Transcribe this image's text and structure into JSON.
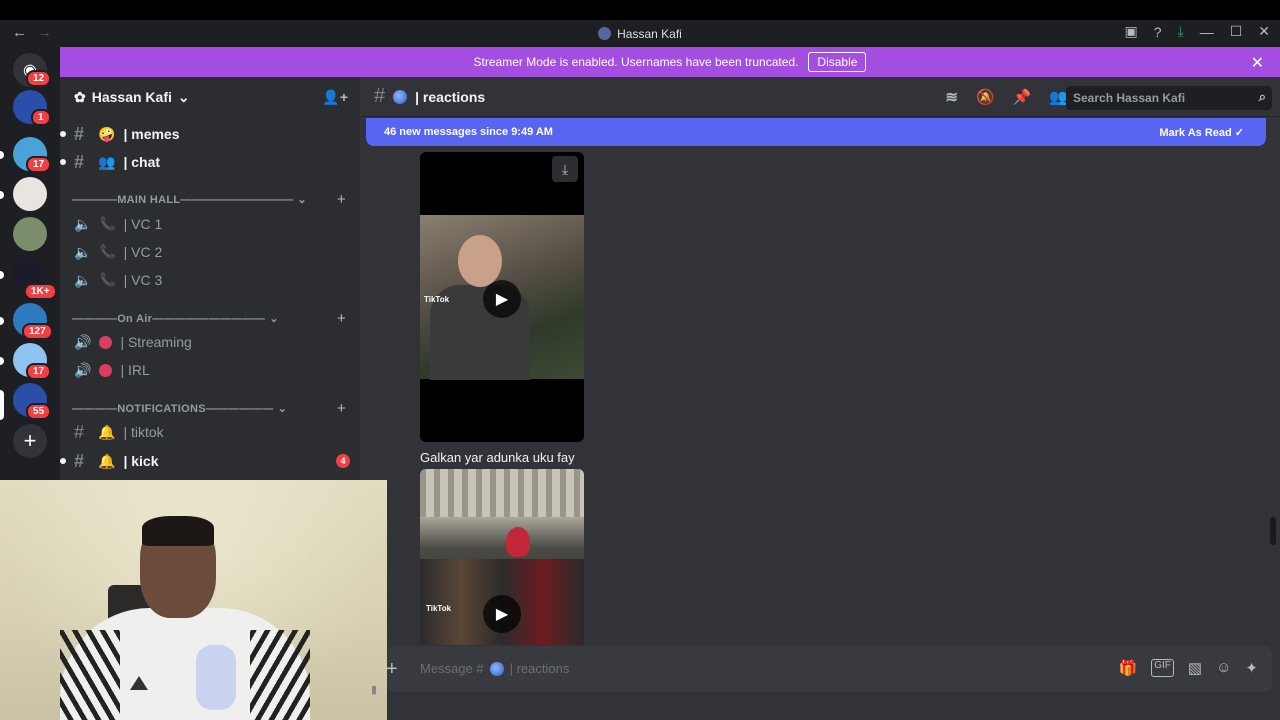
{
  "window": {
    "title": "Hassan Kafi",
    "back": "←",
    "forward": "→"
  },
  "banner": {
    "text": "Streamer Mode is enabled. Usernames have been truncated.",
    "button": "Disable",
    "close": "✕"
  },
  "servers": [
    {
      "name": "discord-home",
      "badge": "12",
      "color": "#5865f2"
    },
    {
      "name": "server-1",
      "badge": "1",
      "color": "#2b4fa8"
    },
    {
      "name": "server-2",
      "badge": "17",
      "color": "#4aa3d8"
    },
    {
      "name": "server-3",
      "badge": "",
      "color": "#e8e4df"
    },
    {
      "name": "server-4",
      "badge": "",
      "color": "#7b8d6a"
    },
    {
      "name": "server-5",
      "badge": "1K+",
      "color": "#1b1b2a"
    },
    {
      "name": "server-6",
      "badge": "127",
      "color": "#2d7bbf"
    },
    {
      "name": "server-7",
      "badge": "17",
      "color": "#8fc3f0"
    },
    {
      "name": "server-8",
      "badge": "55",
      "color": "#2b4fa8"
    }
  ],
  "guild": {
    "name": "Hassan Kafi",
    "chevron": "⌄"
  },
  "channels": {
    "memes": "| memes",
    "chat": "| chat",
    "cat_main": "————MAIN HALL——————————",
    "vc1": "| VC 1",
    "vc2": "| VC 2",
    "vc3": "| VC 3",
    "cat_onair": "————On Air——————————",
    "streaming": "| Streaming",
    "irl": "| IRL",
    "cat_notif": "————NOTIFICATIONS——————",
    "tiktok": "| tiktok",
    "kick": "| kick",
    "kick_count": "4"
  },
  "header": {
    "channel": "| reactions",
    "search_placeholder": "Search Hassan Kafi"
  },
  "newmessages": {
    "text": "46 new messages since 9:49 AM",
    "mark": "Mark As Read"
  },
  "messages": {
    "video1_tag": "TikTok",
    "caption": "Galkan yar adunka uku fay",
    "video2_tag": "TikTok"
  },
  "composer": {
    "placeholder_prefix": "Message #",
    "placeholder_channel": "| reactions"
  },
  "icons": {
    "header": [
      "threads-icon",
      "mute-icon",
      "pin-icon",
      "members-icon"
    ],
    "composer": [
      "gift-icon",
      "gif-icon",
      "sticker-icon",
      "emoji-icon",
      "apps-icon"
    ]
  },
  "colors": {
    "accent": "#5865f2",
    "banner": "#a34ee0",
    "badge": "#f23f43"
  }
}
